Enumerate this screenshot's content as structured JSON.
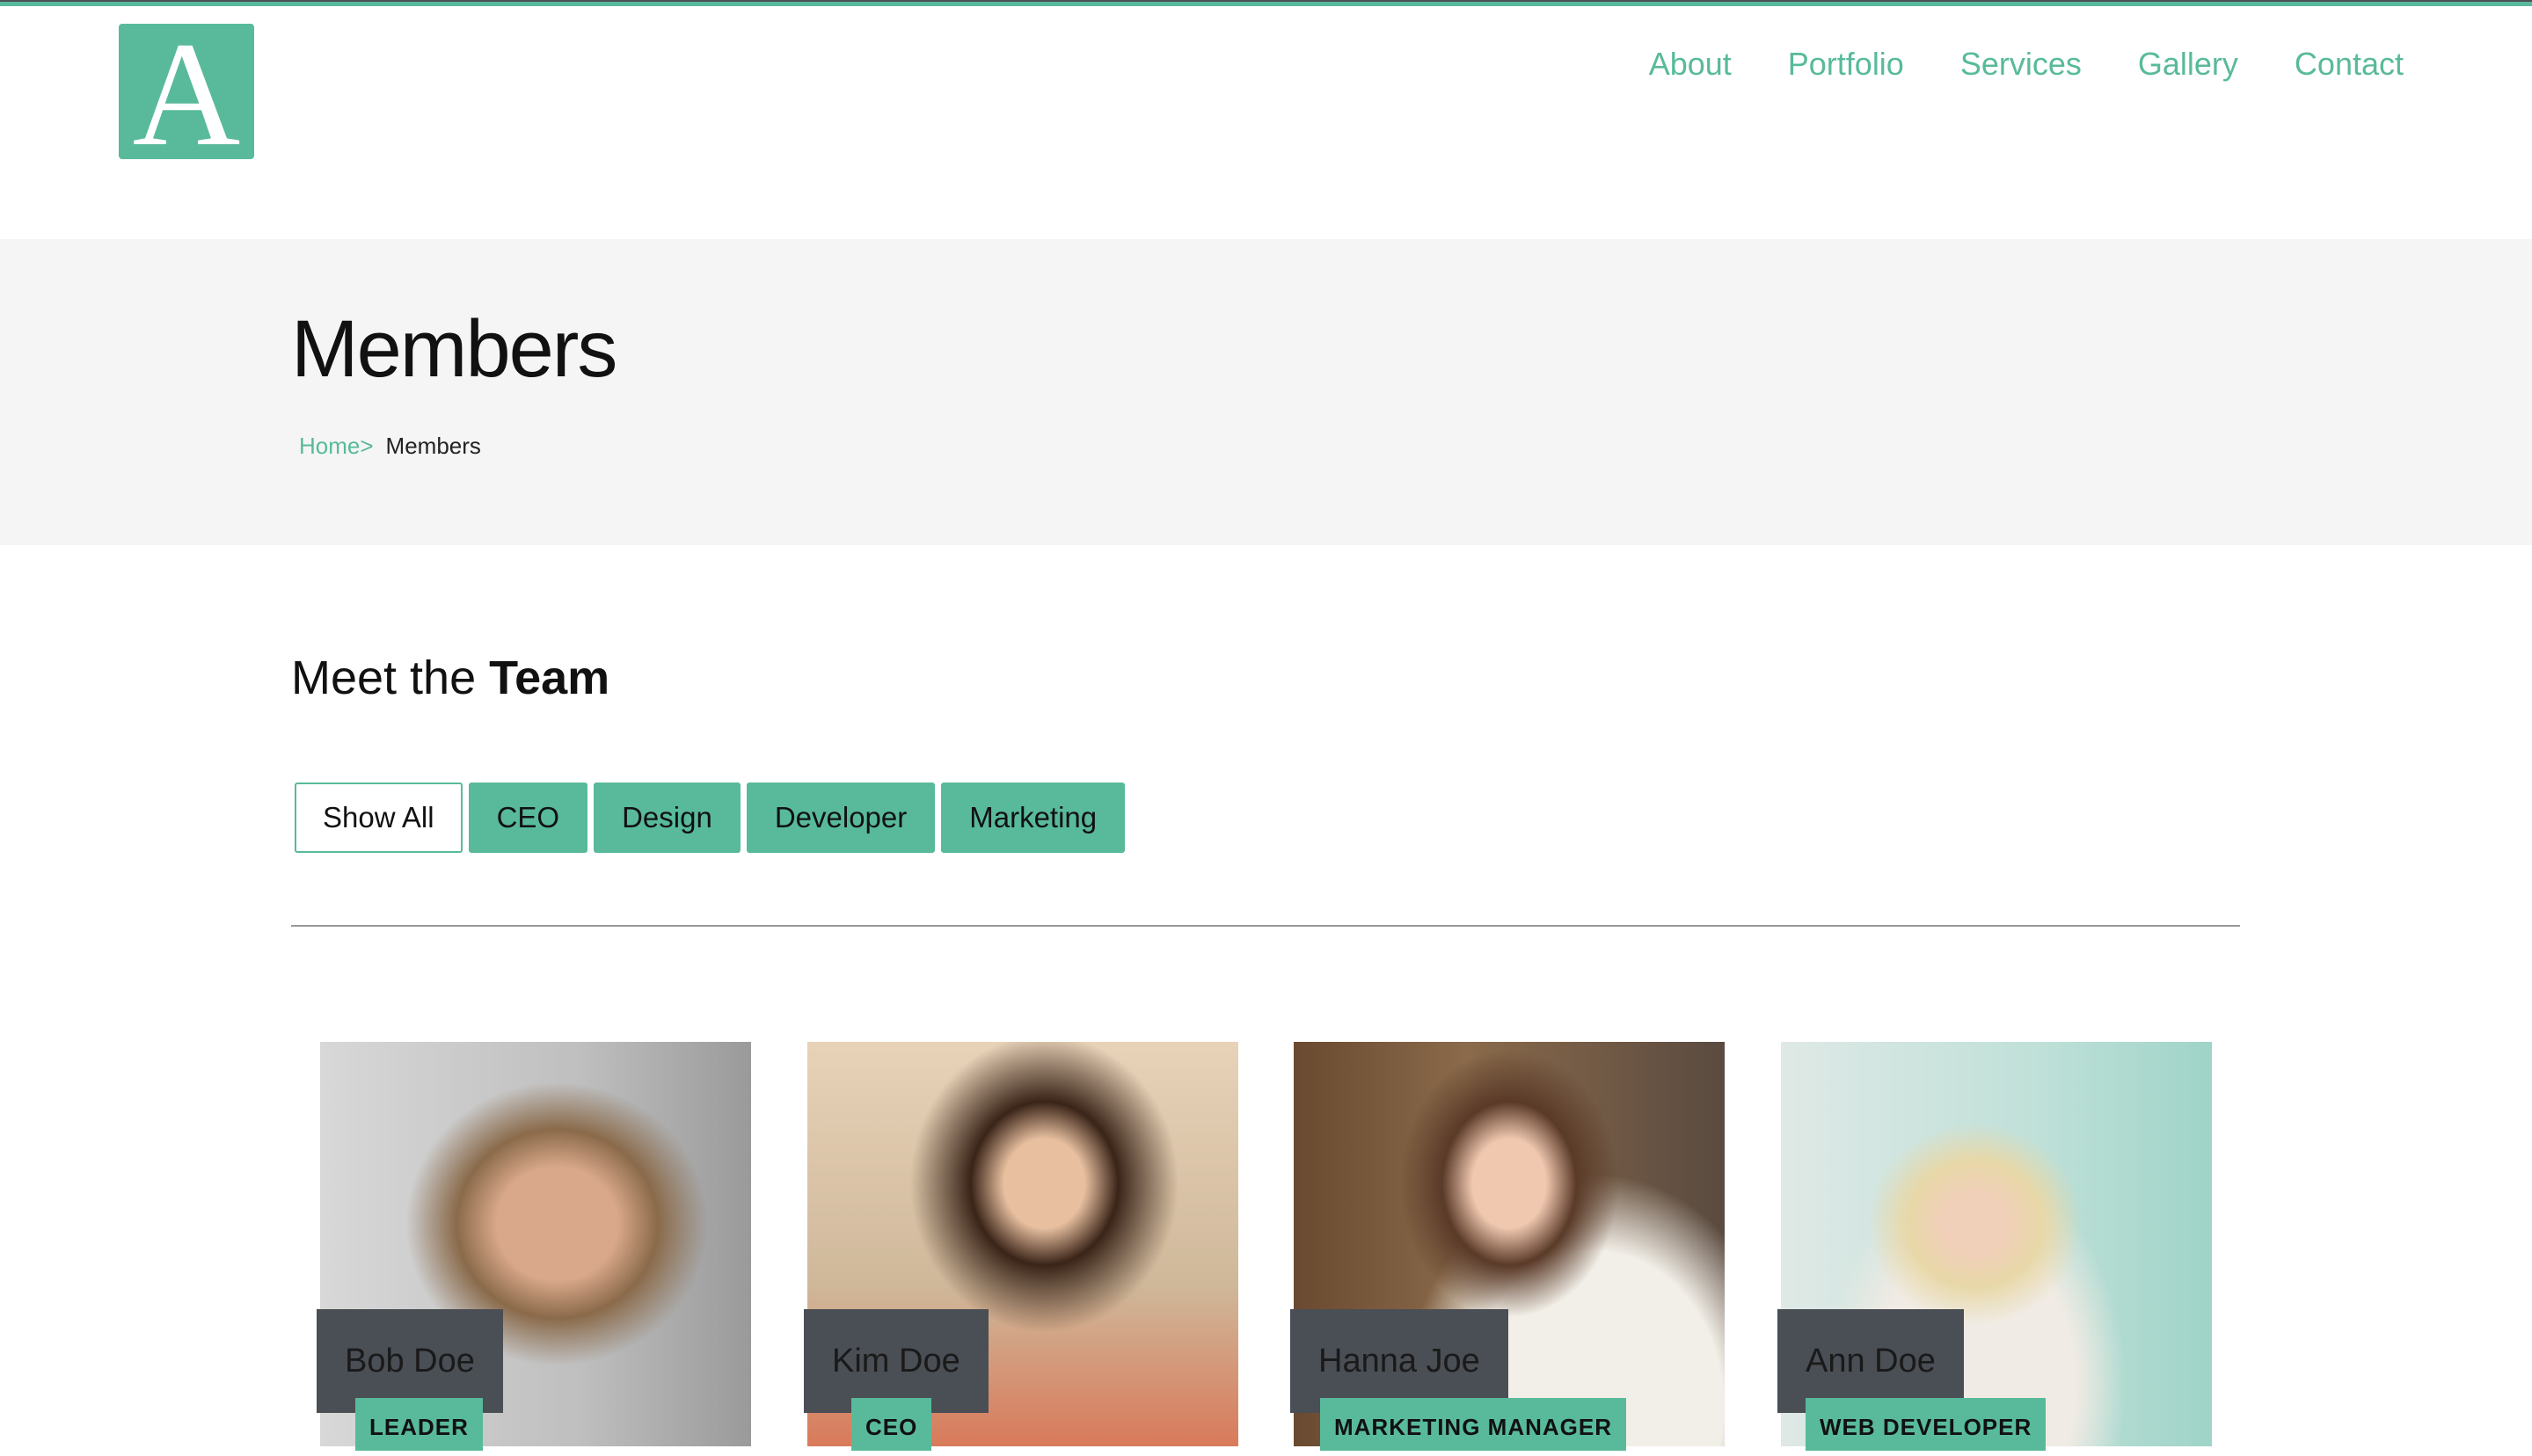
{
  "logo": {
    "letter": "A"
  },
  "nav": [
    "About",
    "Portfolio",
    "Services",
    "Gallery",
    "Contact"
  ],
  "page": {
    "title": "Members",
    "breadcrumb": {
      "home": "Home>",
      "current": "Members"
    }
  },
  "section": {
    "title_light": "Meet the ",
    "title_bold": "Team"
  },
  "filters": [
    "Show All",
    "CEO",
    "Design",
    "Developer",
    "Marketing"
  ],
  "members": [
    {
      "name": "Bob Doe",
      "role": "LEADER"
    },
    {
      "name": "Kim Doe",
      "role": "CEO"
    },
    {
      "name": "Hanna Joe",
      "role": "MARKETING MANAGER"
    },
    {
      "name": "Ann Doe",
      "role": "WEB DEVELOPER"
    }
  ],
  "colors": {
    "accent": "#58ba9b",
    "dark": "#4a4e55",
    "band": "#f5f5f5"
  }
}
